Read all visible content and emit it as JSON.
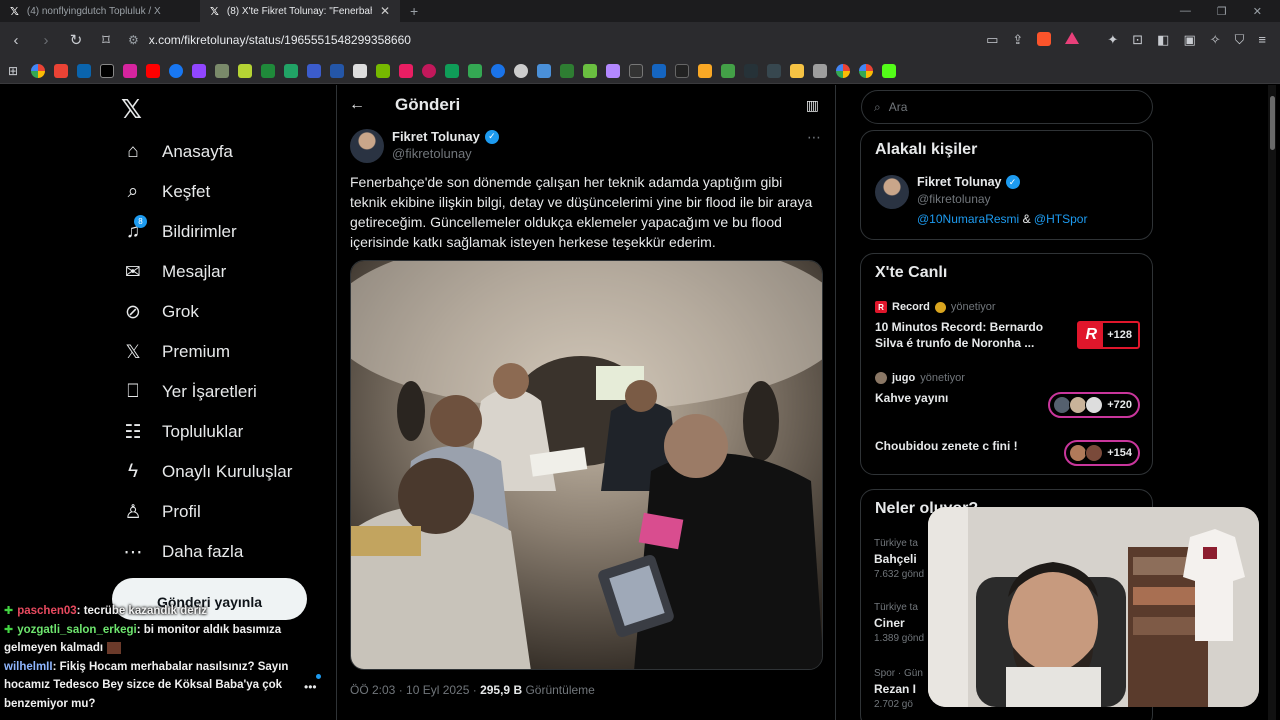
{
  "browser": {
    "tabs": [
      {
        "title": "(4) nonflyingdutch Topluluk / X",
        "active": false
      },
      {
        "title": "(8) X'te Fikret Tolunay: \"Fenerbahçe",
        "active": true
      }
    ],
    "url": "x.com/fikretolunay/status/1965551548299358660"
  },
  "nav": {
    "items": [
      {
        "label": "Anasayfa",
        "icon": "home-icon"
      },
      {
        "label": "Keşfet",
        "icon": "search-icon"
      },
      {
        "label": "Bildirimler",
        "icon": "bell-icon",
        "badge": "8"
      },
      {
        "label": "Mesajlar",
        "icon": "mail-icon"
      },
      {
        "label": "Grok",
        "icon": "grok-icon"
      },
      {
        "label": "Premium",
        "icon": "x-icon"
      },
      {
        "label": "Yer İşaretleri",
        "icon": "bookmark-icon"
      },
      {
        "label": "Topluluklar",
        "icon": "people-icon"
      },
      {
        "label": "Onaylı Kuruluşlar",
        "icon": "lightning-icon"
      },
      {
        "label": "Profil",
        "icon": "person-icon"
      },
      {
        "label": "Daha fazla",
        "icon": "more-icon"
      }
    ],
    "post_button": "Gönderi yayınla"
  },
  "chat": [
    {
      "user": "paschen03",
      "message": ": tecrübe kazandık deriz"
    },
    {
      "user": "yozgatli_salon_erkegi",
      "message": ": bi monitor aldık basımıza gelmeyen kalmadı"
    },
    {
      "user": "wilhelmII",
      "message": ": Fikiş Hocam merhabalar nasılsınız? Sayın hocamız Tedesco Bey sizce de Köksal Baba'ya çok benzemiyor mu?"
    }
  ],
  "post": {
    "header_title": "Gönderi",
    "author_name": "Fikret Tolunay",
    "author_handle": "@fikretolunay",
    "text": "Fenerbahçe'de son dönemde çalışan her teknik adamda yaptığım gibi teknik ekibine ilişkin bilgi, detay ve düşüncelerimi yine bir flood ile bir araya getireceğim. Güncellemeler oldukça eklemeler yapacağım ve bu flood içerisinde katkı sağlamak isteyen herkese teşekkür ederim.",
    "time": "ÖÖ 2:03 · 10 Eyl 2025 · ",
    "views": "295,9 B",
    "views_label": "Görüntüleme"
  },
  "sidebar": {
    "search_placeholder": "Ara",
    "related": {
      "title": "Alakalı kişiler",
      "name": "Fikret Tolunay",
      "handle": "@fikretolunay",
      "link1": "@10NumaraResmi",
      "amp": "&",
      "link2": "@HTSpor"
    },
    "live": {
      "title": "X'te Canlı",
      "items": [
        {
          "host": "Record",
          "host_suffix": "yönetiyor",
          "title": "10 Minutos Record: Bernardo Silva é trunfo de Noronha ...",
          "count": "+128"
        },
        {
          "host": "jugo",
          "host_suffix": "yönetiyor",
          "title": "Kahve yayını",
          "count": "+720"
        },
        {
          "host": "",
          "host_suffix": "",
          "title": "Choubidou zenete c fini !",
          "count": "+154"
        }
      ]
    },
    "trends": {
      "title": "Neler oluyor?",
      "items": [
        {
          "category": "Türkiye ta",
          "name": "Bahçeli",
          "count": "7.632 gönd"
        },
        {
          "category": "Türkiye ta",
          "name": "Ciner",
          "count": "1.389 gönd"
        },
        {
          "category": "Spor · Gün",
          "name": "Rezan I",
          "count": "2.702 gö"
        }
      ]
    }
  },
  "colors": {
    "accent": "#1d9bf0",
    "background": "#000000",
    "border": "#2f3336",
    "muted": "#71767b"
  }
}
